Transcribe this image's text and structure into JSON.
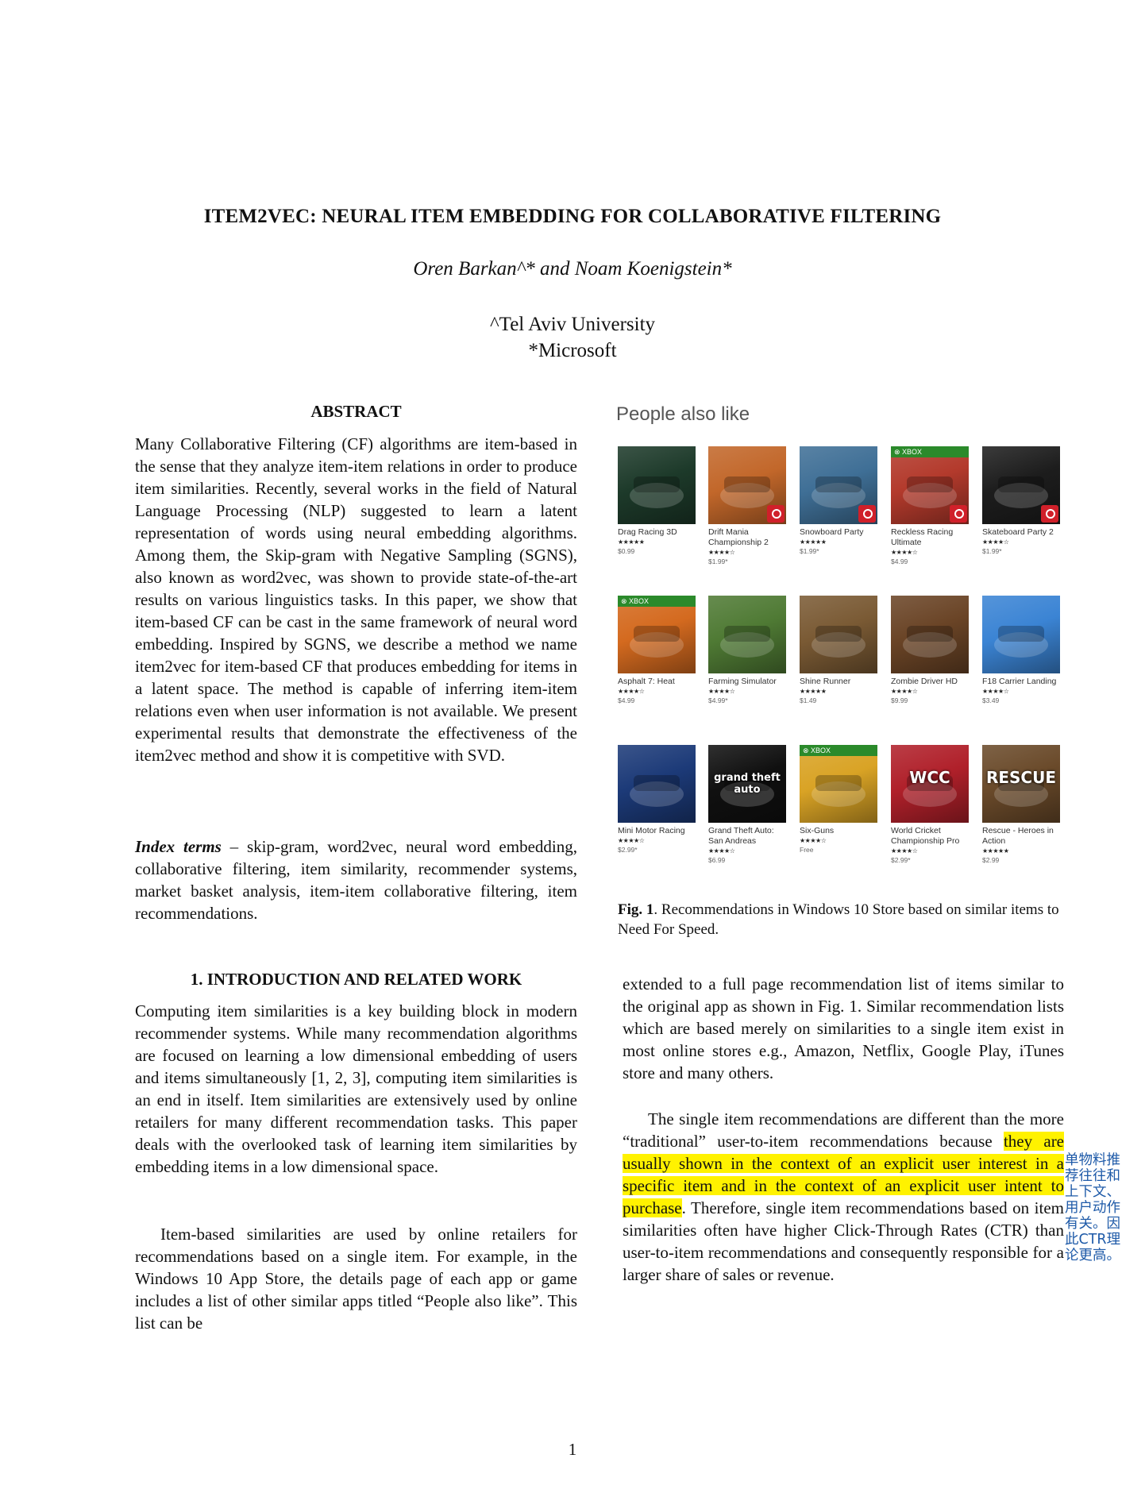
{
  "title": "ITEM2VEC: NEURAL ITEM EMBEDDING FOR COLLABORATIVE FILTERING",
  "authors": "Oren Barkan^* and Noam Koenigstein*",
  "affiliations": [
    "^Tel Aviv University",
    "*Microsoft"
  ],
  "abstract": {
    "heading": "ABSTRACT",
    "text": "Many Collaborative Filtering (CF) algorithms are item-based in the sense that they analyze item-item relations in order to produce item similarities. Recently, several works in the field of Natural Language Processing (NLP) suggested to learn a latent representation of words using neural embedding algorithms. Among them, the Skip-gram with Negative Sampling (SGNS), also known as word2vec, was shown to provide state-of-the-art results on various linguistics tasks. In this paper, we show that item-based CF can be cast in the same framework of neural word embedding. Inspired by SGNS, we describe a method we name item2vec for item-based CF that produces embedding for items in a latent space. The method is capable of inferring item-item relations even when user information is not available. We present experimental results that demonstrate the effectiveness of the item2vec method and show it is competitive with SVD."
  },
  "index_terms": {
    "label": "Index terms",
    "text": " – skip-gram, word2vec, neural word embedding, collaborative filtering, item similarity, recommender systems, market basket analysis, item-item collaborative filtering, item recommendations."
  },
  "section1": {
    "heading": "1. INTRODUCTION AND RELATED WORK",
    "para1": "Computing item similarities is a key building block in modern recommender systems. While many recommendation algorithms are focused on learning a low dimensional embedding of users and items simultaneously [1, 2, 3], computing item similarities is an end in itself. Item similarities are extensively used by online retailers for many different recommendation tasks. This paper deals with the overlooked task of learning item similarities by embedding items in a low dimensional space.",
    "para2": "Item-based similarities are used by online retailers for recommendations based on a single item. For example, in the Windows 10 App Store, the details page of each app or game includes a list of other similar apps titled “People also like”. This list can be"
  },
  "right_text": {
    "para1": "extended to a full page recommendation list of items similar to the original app as shown in Fig. 1. Similar recommendation lists which are based merely on similarities to a single item exist in most online stores e.g., Amazon, Netflix, Google Play, iTunes store and many others.",
    "para2_before": "The single item recommendations are different than the more “traditional” user-to-item recommendations because ",
    "para2_highlight": "they are usually shown in the context of an explicit user interest in a specific item and in the context of an explicit user intent to purchase",
    "para2_after": ". Therefore, single item recommendations based on item similarities often have higher Click-Through Rates (CTR) than user-to-item recommendations and consequently responsible for a larger share of sales or revenue."
  },
  "annotation": "单物料推荐往往和上下文、用户动作有关。因此CTR理论更高。",
  "figure": {
    "heading": "People also like",
    "caption_label": "Fig. 1",
    "caption_text": ". Recommendations in Windows 10 Store based on similar items to Need For Speed.",
    "xbox_label": "XBOX",
    "tiles": [
      {
        "name": "Drag Racing 3D",
        "stars": "★★★★★",
        "price": "$0.99",
        "color": "#1d3a2a",
        "xbox": false,
        "badge": false
      },
      {
        "name": "Drift Mania Championship 2",
        "stars": "★★★★☆",
        "price": "$1.99*",
        "color": "#c2672a",
        "xbox": false,
        "badge": true
      },
      {
        "name": "Snowboard Party",
        "stars": "★★★★★",
        "price": "$1.99*",
        "color": "#3f6f96",
        "xbox": false,
        "badge": true
      },
      {
        "name": "Reckless Racing Ultimate",
        "stars": "★★★★☆",
        "price": "$4.99",
        "color": "#b33a2c",
        "xbox": true,
        "badge": true
      },
      {
        "name": "Skateboard Party 2",
        "stars": "★★★★☆",
        "price": "$1.99*",
        "color": "#1d1d1d",
        "xbox": false,
        "badge": true
      },
      {
        "name": "Asphalt 7: Heat",
        "stars": "★★★★☆",
        "price": "$4.99",
        "color": "#d46a1f",
        "xbox": true,
        "badge": false
      },
      {
        "name": "Farming Simulator",
        "stars": "★★★★☆",
        "price": "$4.99*",
        "color": "#4f7a34",
        "xbox": false,
        "badge": false
      },
      {
        "name": "Shine Runner",
        "stars": "★★★★★",
        "price": "$1.49",
        "color": "#7a5a34",
        "xbox": false,
        "badge": false
      },
      {
        "name": "Zombie Driver HD",
        "stars": "★★★★☆",
        "price": "$9.99",
        "color": "#6a4426",
        "xbox": false,
        "badge": false
      },
      {
        "name": "F18 Carrier Landing",
        "stars": "★★★★☆",
        "price": "$3.49",
        "color": "#3b84d4",
        "xbox": false,
        "badge": false
      },
      {
        "name": "Mini Motor Racing",
        "stars": "★★★★☆",
        "price": "$2.99*",
        "color": "#1c3a78",
        "xbox": false,
        "badge": false
      },
      {
        "name": "Grand Theft Auto: San Andreas",
        "stars": "★★★★☆",
        "price": "$6.99",
        "color": "#101010",
        "xbox": false,
        "badge": false
      },
      {
        "name": "Six-Guns",
        "stars": "★★★★☆",
        "price": "Free",
        "color": "#d9a325",
        "xbox": true,
        "badge": false
      },
      {
        "name": "World Cricket Championship Pro",
        "stars": "★★★★☆",
        "price": "$2.99*",
        "color": "#b0202a",
        "xbox": false,
        "badge": false
      },
      {
        "name": "Rescue - Heroes in Action",
        "stars": "★★★★★",
        "price": "$2.99",
        "color": "#6a4a2a",
        "xbox": false,
        "badge": false
      }
    ],
    "tile_labels": {
      "wcc": "WCC",
      "rescue": "RESCUE",
      "gta": "grand theft auto"
    }
  },
  "page_number": "1"
}
